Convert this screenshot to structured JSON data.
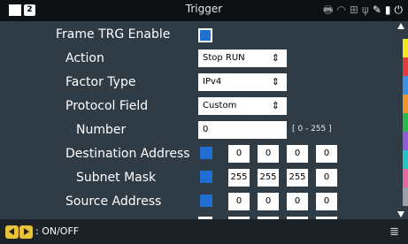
{
  "window": {
    "title": "Trigger",
    "badge_number": "2"
  },
  "status_icons": [
    "printer-icon",
    "wifi-icon",
    "network-icon",
    "usb-icon",
    "edit-icon",
    "storage-icon",
    "power-plug-icon"
  ],
  "rows": {
    "frame_trg_enable": {
      "label": "Frame TRG Enable",
      "checked": true
    },
    "action": {
      "label": "Action",
      "value": "Stop RUN"
    },
    "factor_type": {
      "label": "Factor Type",
      "value": "IPv4"
    },
    "protocol_field": {
      "label": "Protocol Field",
      "value": "Custom"
    },
    "number": {
      "label": "Number",
      "value": "0",
      "range": "[ 0 - 255 ]"
    },
    "destination_address": {
      "label": "Destination Address",
      "octets": [
        "0",
        "0",
        "0",
        "0"
      ]
    },
    "subnet_mask": {
      "label": "Subnet Mask",
      "octets": [
        "255",
        "255",
        "255",
        "0"
      ]
    },
    "source_address": {
      "label": "Source Address",
      "octets": [
        "0",
        "0",
        "0",
        "0"
      ]
    }
  },
  "bottom": {
    "label": ": ON/OFF"
  },
  "colors": {
    "background": "#2f3b45",
    "accent_blue": "#1f6fd0",
    "nav_yellow": "#e8c23a",
    "channel_stripes": [
      "#f5e61e",
      "#e23c3c",
      "#3c8fe2",
      "#e8962e",
      "#2fb84a",
      "#8b5cd6",
      "#28c4c4",
      "#e26aa0",
      "#9aa0a6"
    ]
  }
}
